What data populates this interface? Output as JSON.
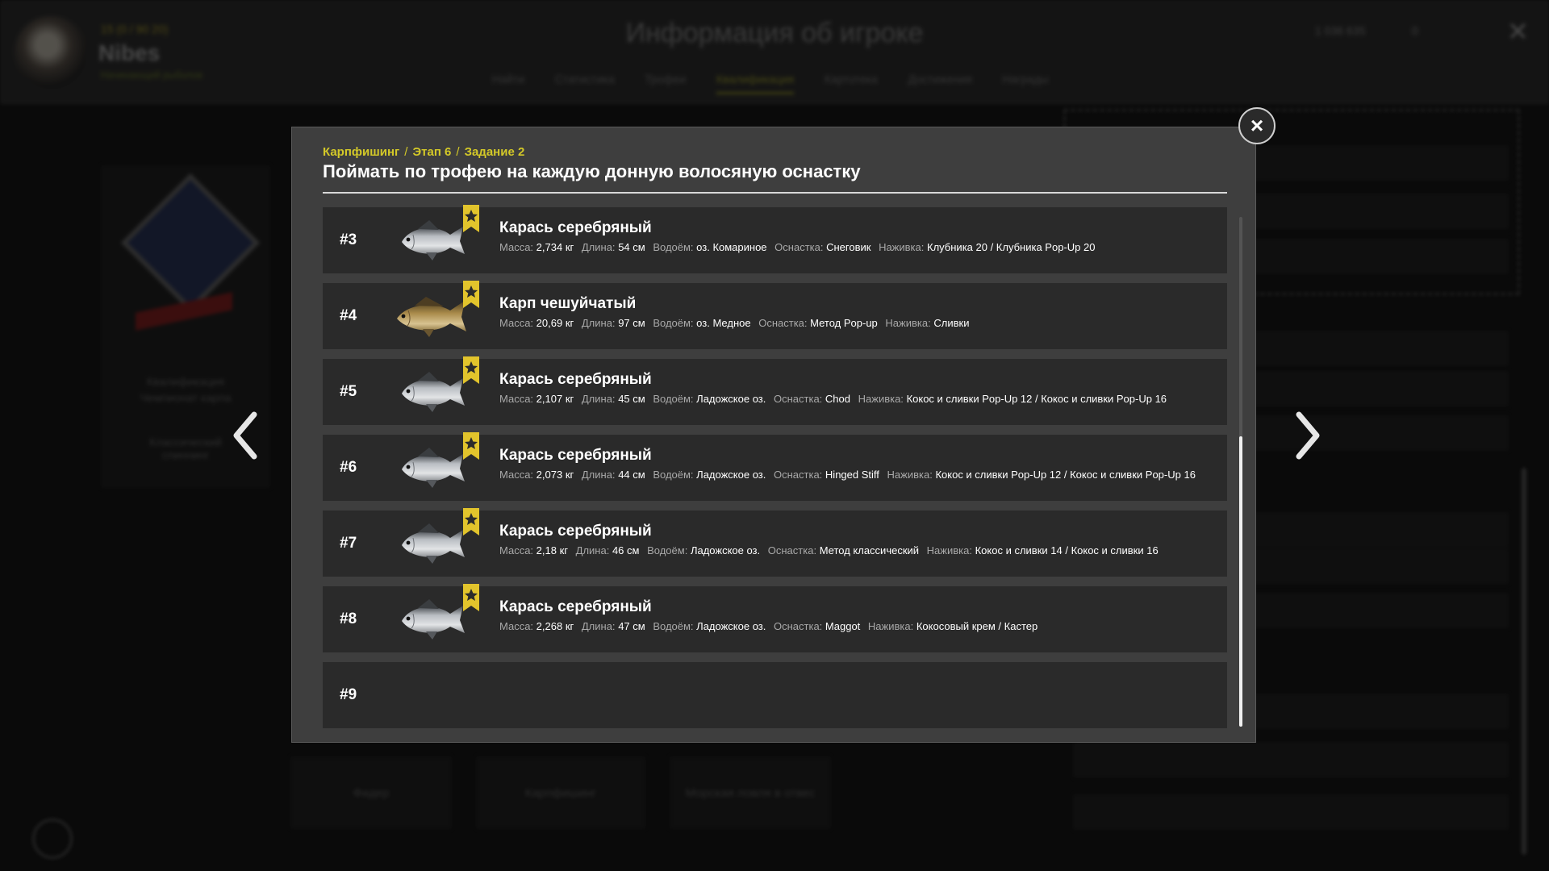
{
  "background": {
    "player_level": "15 (0 / 90 20)",
    "player_name": "Nibes",
    "player_status": "Начинающий рыболов",
    "page_title": "Информация об игроке",
    "tabs": [
      "Найти",
      "Статистика",
      "Трофеи",
      "Квалификация",
      "Картотека",
      "Достижения",
      "Награды"
    ],
    "active_tab_index": 3,
    "currency_silver": "1 036 635",
    "currency_gold": "0",
    "league_card_lines": [
      "Квалификация",
      "Чемпионат карпа"
    ],
    "league_card_caption": "Классический спиннинг",
    "bottom_tabs": [
      "Фидер",
      "Карпфишинг",
      "Морская ловля в отвес"
    ]
  },
  "modal": {
    "breadcrumb": [
      "Карпфишинг",
      "Этап 6",
      "Задание 2"
    ],
    "breadcrumb_separator": "/",
    "title": "Поймать по трофею на каждую донную волосяную оснастку",
    "labels": {
      "mass": "Масса:",
      "length": "Длина:",
      "water": "Водоём:",
      "rig": "Оснастка:",
      "bait": "Наживка:"
    },
    "rows": [
      {
        "rank": "#3",
        "fish": "Карась серебряный",
        "fish_icon": "crucian-carp-icon",
        "mass": "2,734 кг",
        "length": "54 см",
        "water": "оз. Комариное",
        "rig": "Снеговик",
        "bait": "Клубника 20 / Клубника Pop-Up 20"
      },
      {
        "rank": "#4",
        "fish": "Карп чешуйчатый",
        "fish_icon": "carp-icon",
        "mass": "20,69 кг",
        "length": "97 см",
        "water": "оз. Медное",
        "rig": "Метод Pop-up",
        "bait": "Сливки"
      },
      {
        "rank": "#5",
        "fish": "Карась серебряный",
        "fish_icon": "crucian-carp-icon",
        "mass": "2,107 кг",
        "length": "45 см",
        "water": "Ладожское оз.",
        "rig": "Chod",
        "bait": "Кокос и сливки Pop-Up 12 / Кокос и сливки Pop-Up 16"
      },
      {
        "rank": "#6",
        "fish": "Карась серебряный",
        "fish_icon": "crucian-carp-icon",
        "mass": "2,073 кг",
        "length": "44 см",
        "water": "Ладожское оз.",
        "rig": "Hinged Stiff",
        "bait": "Кокос и сливки Pop-Up 12 / Кокос и сливки Pop-Up 16"
      },
      {
        "rank": "#7",
        "fish": "Карась серебряный",
        "fish_icon": "crucian-carp-icon",
        "mass": "2,18 кг",
        "length": "46 см",
        "water": "Ладожское оз.",
        "rig": "Метод классический",
        "bait": "Кокос и сливки 14 / Кокос и сливки 16"
      },
      {
        "rank": "#8",
        "fish": "Карась серебряный",
        "fish_icon": "crucian-carp-icon",
        "mass": "2,268 кг",
        "length": "47 см",
        "water": "Ладожское оз.",
        "rig": "Maggot",
        "bait": "Кокосовый крем / Кастер"
      }
    ],
    "empty_row": {
      "rank": "#9"
    },
    "close_label": "×",
    "colors": {
      "accent": "#d4c928",
      "trophy_flag": "#e2c42c"
    }
  }
}
